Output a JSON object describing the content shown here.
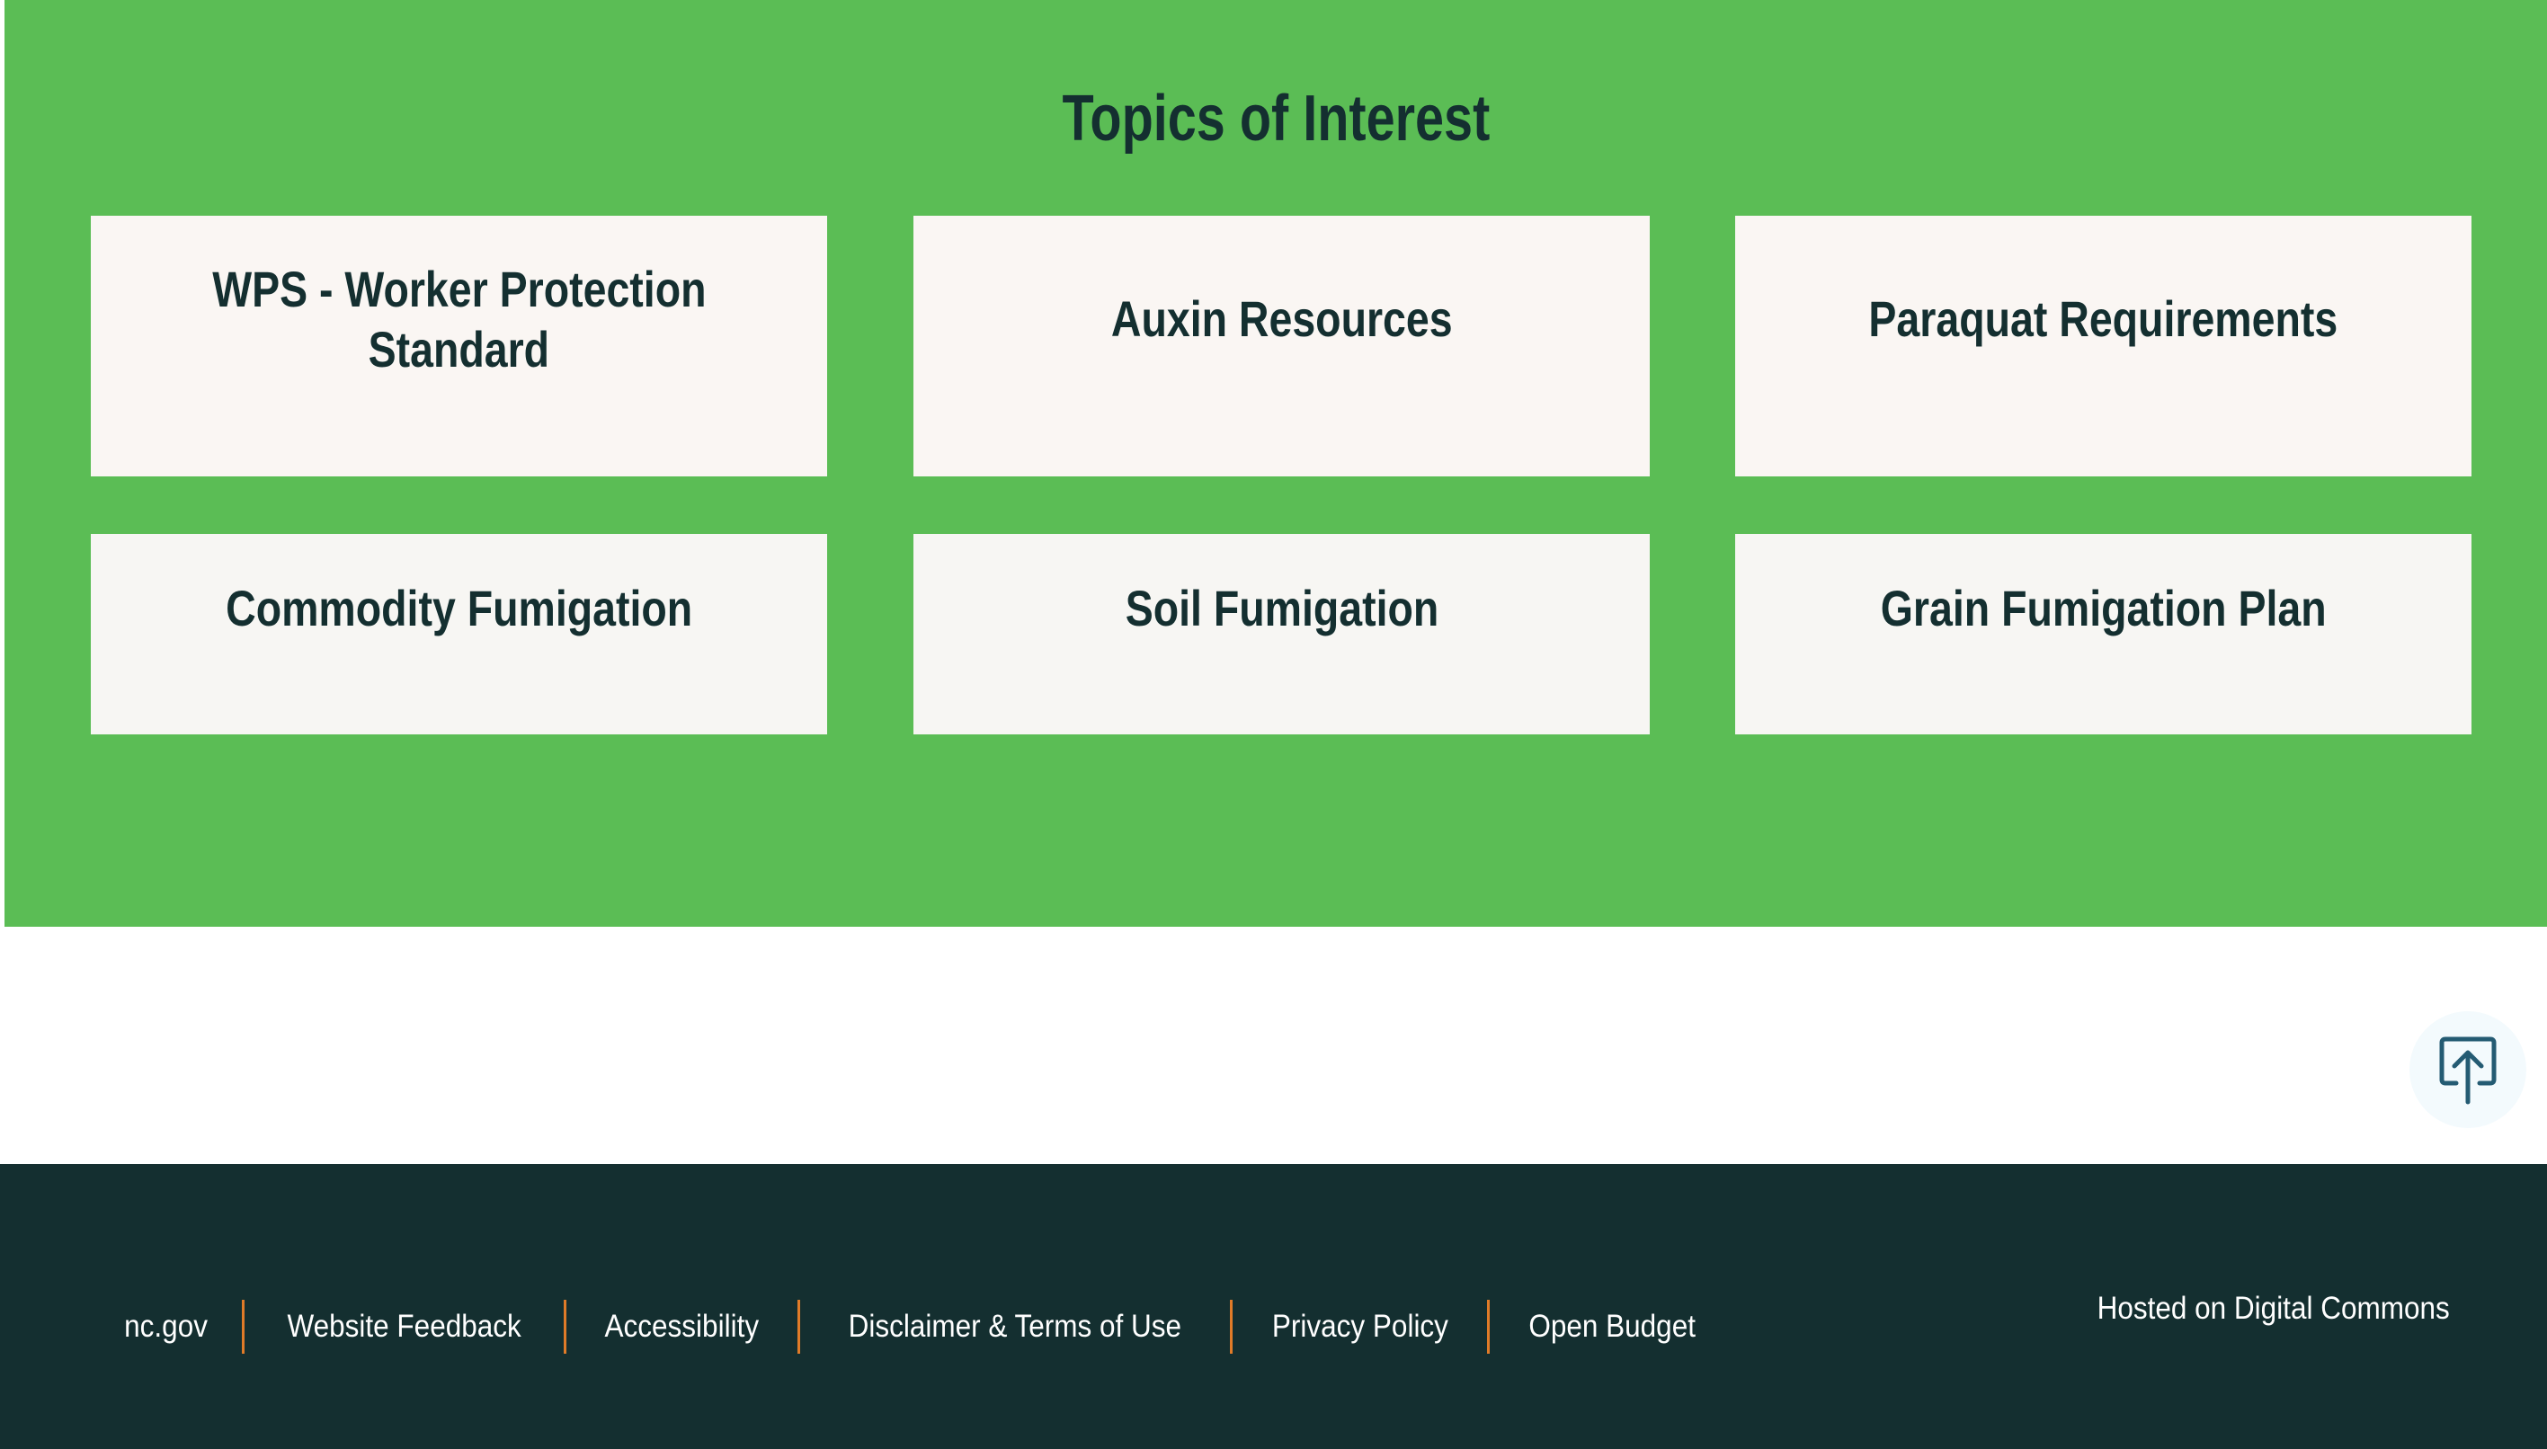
{
  "topics": {
    "title": "Topics of Interest",
    "cards": [
      {
        "lines": [
          "WPS - Worker Protection",
          "Standard"
        ]
      },
      {
        "lines": [
          "Auxin Resources"
        ]
      },
      {
        "lines": [
          "Paraquat Requirements"
        ]
      },
      {
        "lines": [
          "Commodity Fumigation"
        ]
      },
      {
        "lines": [
          "Soil Fumigation"
        ]
      },
      {
        "lines": [
          "Grain Fumigation Plan"
        ]
      }
    ]
  },
  "scroll_top": {
    "icon": "scroll-to-top-icon"
  },
  "footer": {
    "links": [
      {
        "label": "nc.gov"
      },
      {
        "label": "Website Feedback"
      },
      {
        "label": "Accessibility"
      },
      {
        "label": "Disclaimer & Terms of Use"
      },
      {
        "label": "Privacy Policy"
      },
      {
        "label": "Open Budget"
      }
    ],
    "hosted_label": "Hosted on Digital Commons"
  },
  "colors": {
    "section_green": "#5bbd55",
    "card_background": "#faf6f3",
    "heading_text": "#142f30",
    "footer_background": "#142f30",
    "footer_separator": "#e07b28",
    "scroll_button_background": "#f3fafd",
    "scroll_icon": "#245b73"
  }
}
